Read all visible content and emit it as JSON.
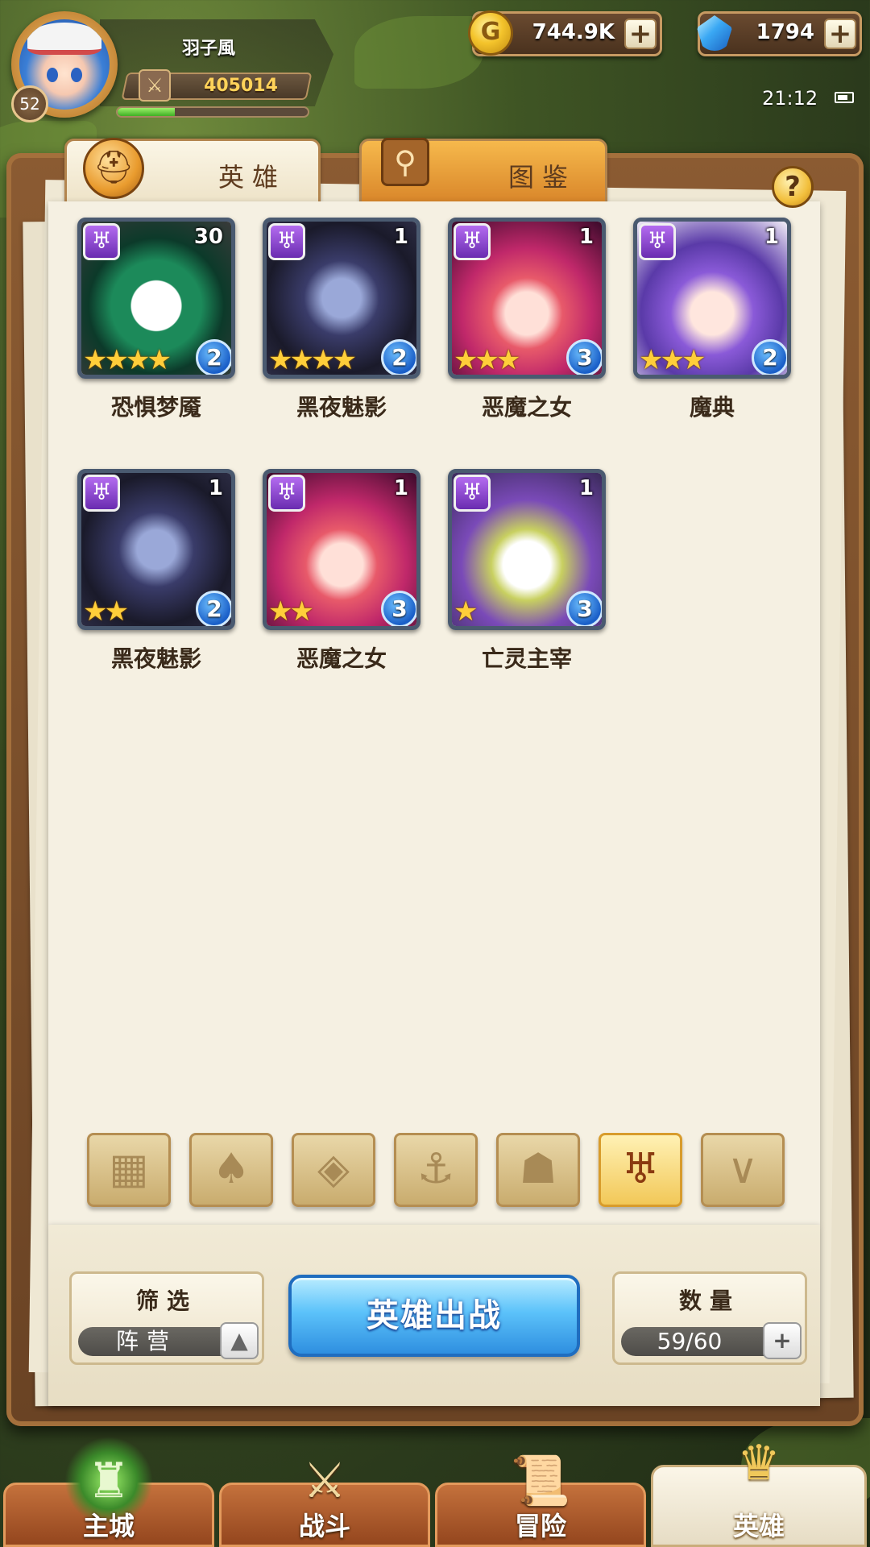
{
  "player": {
    "name": "羽子風",
    "level": "52",
    "power": "405014",
    "exp_progress_pct": 30
  },
  "currency": {
    "gold": "744.9K",
    "gems": "1794"
  },
  "status_bar": {
    "time": "21:12"
  },
  "tabs": [
    {
      "label": "英雄",
      "active": true
    },
    {
      "label": "图鉴",
      "active": false
    }
  ],
  "heroes": [
    {
      "name": "恐惧梦魇",
      "level": "30",
      "stars": 4,
      "grade": "2",
      "palette": "jester"
    },
    {
      "name": "黑夜魅影",
      "level": "1",
      "stars": 4,
      "grade": "2",
      "palette": "shadow"
    },
    {
      "name": "恶魔之女",
      "level": "1",
      "stars": 3,
      "grade": "3",
      "palette": "demon"
    },
    {
      "name": "魔典",
      "level": "1",
      "stars": 3,
      "grade": "2",
      "palette": "tome"
    },
    {
      "name": "黑夜魅影",
      "level": "1",
      "stars": 2,
      "grade": "2",
      "palette": "shadow"
    },
    {
      "name": "恶魔之女",
      "level": "1",
      "stars": 2,
      "grade": "3",
      "palette": "demon"
    },
    {
      "name": "亡灵主宰",
      "level": "1",
      "stars": 1,
      "grade": "3",
      "palette": "undead"
    }
  ],
  "faction_filters": [
    {
      "icon": "grid-icon",
      "glyph": "▦",
      "active": false
    },
    {
      "icon": "leaf-icon",
      "glyph": "♠",
      "active": false
    },
    {
      "icon": "diamond-icon",
      "glyph": "◈",
      "active": false
    },
    {
      "icon": "anchor-icon",
      "glyph": "⚓",
      "active": false
    },
    {
      "icon": "beast-icon",
      "glyph": "☗",
      "active": false
    },
    {
      "icon": "demon-horns-icon",
      "glyph": "♅",
      "active": true
    },
    {
      "icon": "chevron-wing-icon",
      "glyph": "∨",
      "active": false
    }
  ],
  "controls": {
    "filter_title": "筛选",
    "filter_value": "阵营",
    "deploy_label": "英雄出战",
    "count_title": "数量",
    "count_value": "59/60"
  },
  "nav": [
    {
      "label": "主城",
      "icon": "castle-icon",
      "active": false
    },
    {
      "label": "战斗",
      "icon": "crossed-swords-icon",
      "active": false
    },
    {
      "label": "冒险",
      "icon": "scroll-map-icon",
      "active": false
    },
    {
      "label": "英雄",
      "icon": "hero-crest-icon",
      "active": true
    }
  ],
  "colors": {
    "faction_badge": "#8a44d4",
    "grade_badge": "#1a5fc8",
    "deploy_button": "#4ab0f4",
    "paper": "#f5f0e2"
  }
}
